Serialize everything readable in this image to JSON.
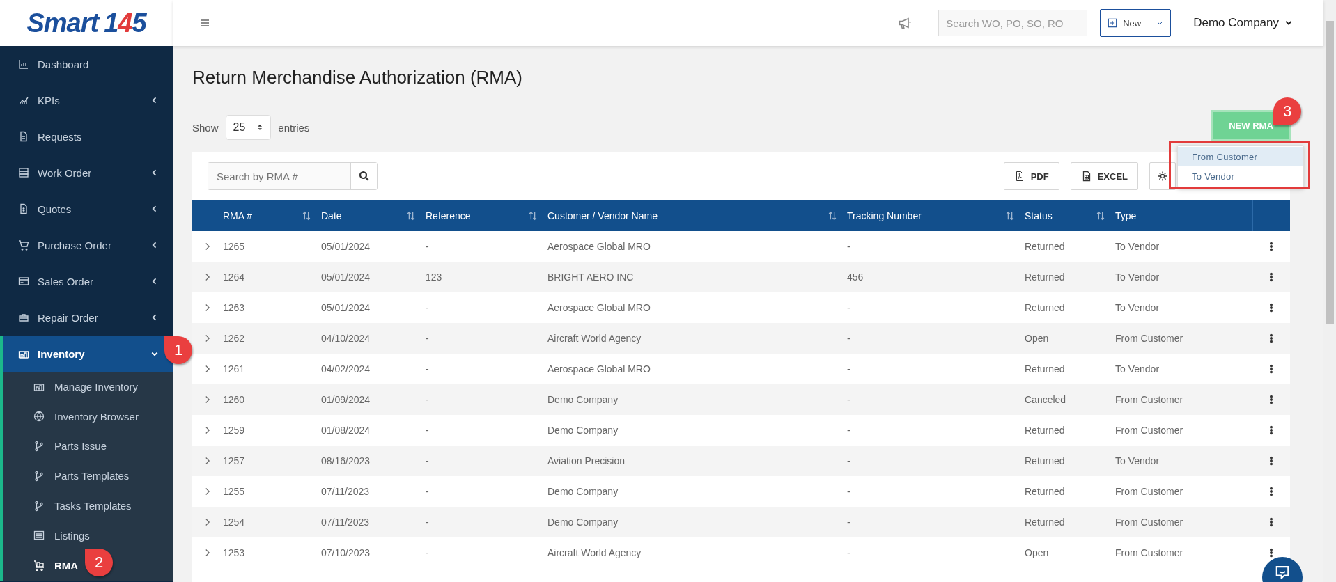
{
  "logo": {
    "word": "Smart",
    "number": "145"
  },
  "sidebar": {
    "items": [
      {
        "label": "Dashboard",
        "selected": false
      },
      {
        "label": "KPIs",
        "selected": false,
        "expanded": false
      },
      {
        "label": "Requests",
        "selected": false
      },
      {
        "label": "Work Order",
        "selected": false,
        "expanded": false
      },
      {
        "label": "Quotes",
        "selected": false,
        "expanded": false
      },
      {
        "label": "Purchase Order",
        "selected": false,
        "expanded": false
      },
      {
        "label": "Sales Order",
        "selected": false,
        "expanded": false
      },
      {
        "label": "Repair Order",
        "selected": false,
        "expanded": false
      },
      {
        "label": "Inventory",
        "selected": true,
        "expanded": true,
        "children": [
          {
            "label": "Manage Inventory",
            "selected": false
          },
          {
            "label": "Inventory Browser",
            "selected": false
          },
          {
            "label": "Parts Issue",
            "selected": false
          },
          {
            "label": "Parts Templates",
            "selected": false
          },
          {
            "label": "Tasks Templates",
            "selected": false
          },
          {
            "label": "Listings",
            "selected": false
          },
          {
            "label": "RMA",
            "selected": true
          }
        ]
      }
    ]
  },
  "header": {
    "search": {
      "placeholder": "Search WO, PO, SO, RO"
    },
    "new_button": "New",
    "company": "Demo Company"
  },
  "page": {
    "title": "Return Merchandise Authorization (RMA)",
    "show_label": "Show",
    "page_size": "25",
    "entries_label": "entries",
    "new_button": "NEW RMA",
    "new_menu": [
      {
        "label": "From Customer",
        "selected": true
      },
      {
        "label": "To Vendor",
        "selected": false
      }
    ]
  },
  "toolbar": {
    "search": {
      "placeholder": "Search by RMA #"
    },
    "buttons": [
      "PDF",
      "EXCEL"
    ]
  },
  "table": {
    "columns": [
      {
        "label": "RMA #",
        "sortable": true
      },
      {
        "label": "Date",
        "sortable": true
      },
      {
        "label": "Reference",
        "sortable": true
      },
      {
        "label": "Customer / Vendor Name",
        "sortable": true
      },
      {
        "label": "Tracking Number",
        "sortable": true
      },
      {
        "label": "Status",
        "sortable": true
      },
      {
        "label": "Type",
        "sortable": false
      }
    ],
    "rows": [
      [
        "1265",
        "05/01/2024",
        "-",
        "Aerospace Global MRO",
        "-",
        "Returned",
        "To Vendor"
      ],
      [
        "1264",
        "05/01/2024",
        "123",
        "BRIGHT AERO INC",
        "456",
        "Returned",
        "To Vendor"
      ],
      [
        "1263",
        "05/01/2024",
        "-",
        "Aerospace Global MRO",
        "-",
        "Returned",
        "To Vendor"
      ],
      [
        "1262",
        "04/10/2024",
        "-",
        "Aircraft World Agency",
        "-",
        "Open",
        "From Customer"
      ],
      [
        "1261",
        "04/02/2024",
        "-",
        "Aerospace Global MRO",
        "-",
        "Returned",
        "To Vendor"
      ],
      [
        "1260",
        "01/09/2024",
        "-",
        "Demo Company",
        "-",
        "Canceled",
        "From Customer"
      ],
      [
        "1259",
        "01/08/2024",
        "-",
        "Demo Company",
        "-",
        "Returned",
        "From Customer"
      ],
      [
        "1257",
        "08/16/2023",
        "-",
        "Aviation Precision",
        "-",
        "Returned",
        "To Vendor"
      ],
      [
        "1255",
        "07/11/2023",
        "-",
        "Demo Company",
        "-",
        "Returned",
        "From Customer"
      ],
      [
        "1254",
        "07/11/2023",
        "-",
        "Demo Company",
        "-",
        "Returned",
        "From Customer"
      ],
      [
        "1253",
        "07/10/2023",
        "-",
        "Aircraft World Agency",
        "-",
        "Open",
        "From Customer"
      ]
    ]
  },
  "callouts": [
    {
      "label": "1"
    },
    {
      "label": "2"
    },
    {
      "label": "3"
    }
  ]
}
